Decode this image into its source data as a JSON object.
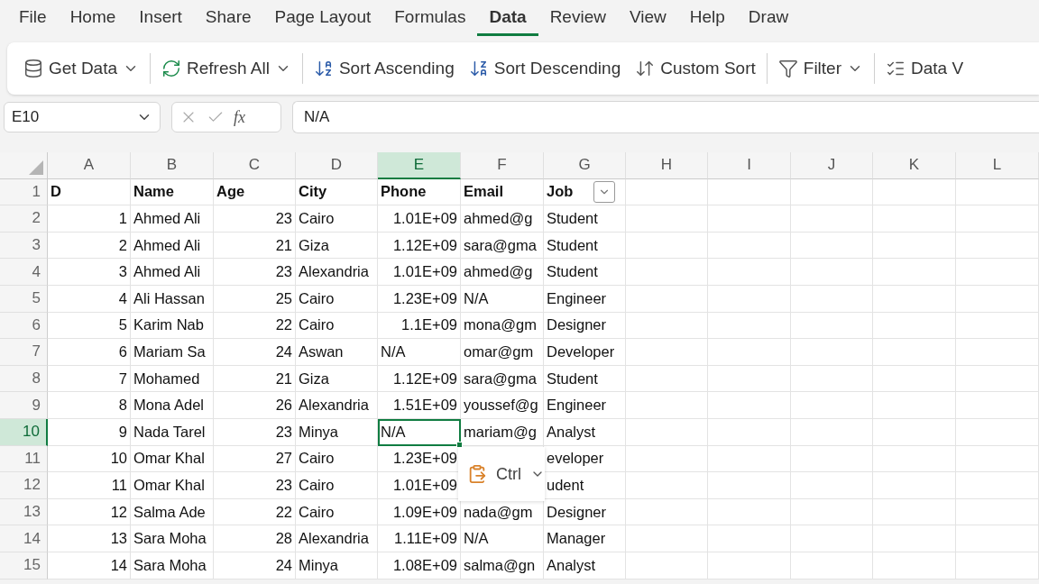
{
  "menu_tabs": [
    {
      "label": "File",
      "selected": false
    },
    {
      "label": "Home",
      "selected": false
    },
    {
      "label": "Insert",
      "selected": false
    },
    {
      "label": "Share",
      "selected": false
    },
    {
      "label": "Page Layout",
      "selected": false
    },
    {
      "label": "Formulas",
      "selected": false
    },
    {
      "label": "Data",
      "selected": true
    },
    {
      "label": "Review",
      "selected": false
    },
    {
      "label": "View",
      "selected": false
    },
    {
      "label": "Help",
      "selected": false
    },
    {
      "label": "Draw",
      "selected": false
    }
  ],
  "toolbar": [
    {
      "kind": "get-data",
      "label": "Get Data",
      "dropdown": true
    },
    {
      "kind": "separator"
    },
    {
      "kind": "refresh",
      "label": "Refresh All",
      "dropdown": true
    },
    {
      "kind": "separator"
    },
    {
      "kind": "sort-asc",
      "label": "Sort Ascending",
      "dropdown": false
    },
    {
      "kind": "sort-desc",
      "label": "Sort Descending",
      "dropdown": false
    },
    {
      "kind": "custom-sort",
      "label": "Custom Sort",
      "dropdown": false
    },
    {
      "kind": "separator"
    },
    {
      "kind": "filter",
      "label": "Filter",
      "dropdown": true
    },
    {
      "kind": "separator"
    },
    {
      "kind": "validation",
      "label": "Data V",
      "dropdown": false
    }
  ],
  "formula_bar": {
    "name_box": "E10",
    "function_label": "fx",
    "value": "N/A"
  },
  "columns": [
    {
      "label": "A",
      "selected": false
    },
    {
      "label": "B",
      "selected": false
    },
    {
      "label": "C",
      "selected": false
    },
    {
      "label": "D",
      "selected": false
    },
    {
      "label": "E",
      "selected": true
    },
    {
      "label": "F",
      "selected": false
    },
    {
      "label": "G",
      "selected": false
    },
    {
      "label": "H",
      "selected": false
    },
    {
      "label": "I",
      "selected": false
    },
    {
      "label": "J",
      "selected": false
    },
    {
      "label": "K",
      "selected": false
    },
    {
      "label": "L",
      "selected": false
    }
  ],
  "rows": [
    {
      "number": "1",
      "selected": false,
      "cells": [
        {
          "text": "D",
          "kind": "heading",
          "selected": false
        },
        {
          "text": "Name",
          "kind": "heading",
          "selected": false
        },
        {
          "text": "Age",
          "kind": "heading",
          "selected": false
        },
        {
          "text": "City",
          "kind": "heading",
          "selected": false
        },
        {
          "text": "Phone",
          "kind": "heading",
          "selected": false
        },
        {
          "text": "Email",
          "kind": "heading",
          "selected": false
        },
        {
          "text": "Job",
          "kind": "heading-filter",
          "selected": false
        }
      ]
    },
    {
      "number": "2",
      "selected": false,
      "cells": [
        {
          "text": "1",
          "kind": "number",
          "selected": false
        },
        {
          "text": "Ahmed Ali",
          "kind": "text",
          "selected": false
        },
        {
          "text": "23",
          "kind": "number",
          "selected": false
        },
        {
          "text": "Cairo",
          "kind": "text",
          "selected": false
        },
        {
          "text": "1.01E+09",
          "kind": "number",
          "selected": false
        },
        {
          "text": "ahmed@g",
          "kind": "text",
          "selected": false
        },
        {
          "text": "Student",
          "kind": "text",
          "selected": false
        }
      ]
    },
    {
      "number": "3",
      "selected": false,
      "cells": [
        {
          "text": "2",
          "kind": "number",
          "selected": false
        },
        {
          "text": "Ahmed Ali",
          "kind": "text",
          "selected": false
        },
        {
          "text": "21",
          "kind": "number",
          "selected": false
        },
        {
          "text": "Giza",
          "kind": "text",
          "selected": false
        },
        {
          "text": "1.12E+09",
          "kind": "number",
          "selected": false
        },
        {
          "text": "sara@gma",
          "kind": "text",
          "selected": false
        },
        {
          "text": "Student",
          "kind": "text",
          "selected": false
        }
      ]
    },
    {
      "number": "4",
      "selected": false,
      "cells": [
        {
          "text": "3",
          "kind": "number",
          "selected": false
        },
        {
          "text": "Ahmed Ali",
          "kind": "text",
          "selected": false
        },
        {
          "text": "23",
          "kind": "number",
          "selected": false
        },
        {
          "text": "Alexandria",
          "kind": "text",
          "selected": false
        },
        {
          "text": "1.01E+09",
          "kind": "number",
          "selected": false
        },
        {
          "text": "ahmed@g",
          "kind": "text",
          "selected": false
        },
        {
          "text": "Student",
          "kind": "text",
          "selected": false
        }
      ]
    },
    {
      "number": "5",
      "selected": false,
      "cells": [
        {
          "text": "4",
          "kind": "number",
          "selected": false
        },
        {
          "text": "Ali Hassan",
          "kind": "text",
          "selected": false
        },
        {
          "text": "25",
          "kind": "number",
          "selected": false
        },
        {
          "text": "Cairo",
          "kind": "text",
          "selected": false
        },
        {
          "text": "1.23E+09",
          "kind": "number",
          "selected": false
        },
        {
          "text": "N/A",
          "kind": "text",
          "selected": false
        },
        {
          "text": "Engineer",
          "kind": "text",
          "selected": false
        }
      ]
    },
    {
      "number": "6",
      "selected": false,
      "cells": [
        {
          "text": "5",
          "kind": "number",
          "selected": false
        },
        {
          "text": "Karim Nab",
          "kind": "text",
          "selected": false
        },
        {
          "text": "22",
          "kind": "number",
          "selected": false
        },
        {
          "text": "Cairo",
          "kind": "text",
          "selected": false
        },
        {
          "text": "1.1E+09",
          "kind": "number",
          "selected": false
        },
        {
          "text": "mona@gm",
          "kind": "text",
          "selected": false
        },
        {
          "text": "Designer",
          "kind": "text",
          "selected": false
        }
      ]
    },
    {
      "number": "7",
      "selected": false,
      "cells": [
        {
          "text": "6",
          "kind": "number",
          "selected": false
        },
        {
          "text": "Mariam Sa",
          "kind": "text",
          "selected": false
        },
        {
          "text": "24",
          "kind": "number",
          "selected": false
        },
        {
          "text": "Aswan",
          "kind": "text",
          "selected": false
        },
        {
          "text": "N/A",
          "kind": "text",
          "selected": false
        },
        {
          "text": "omar@gm",
          "kind": "text",
          "selected": false
        },
        {
          "text": "Developer",
          "kind": "text",
          "selected": false
        }
      ]
    },
    {
      "number": "8",
      "selected": false,
      "cells": [
        {
          "text": "7",
          "kind": "number",
          "selected": false
        },
        {
          "text": "Mohamed",
          "kind": "text",
          "selected": false
        },
        {
          "text": "21",
          "kind": "number",
          "selected": false
        },
        {
          "text": "Giza",
          "kind": "text",
          "selected": false
        },
        {
          "text": "1.12E+09",
          "kind": "number",
          "selected": false
        },
        {
          "text": "sara@gma",
          "kind": "text",
          "selected": false
        },
        {
          "text": "Student",
          "kind": "text",
          "selected": false
        }
      ]
    },
    {
      "number": "9",
      "selected": false,
      "cells": [
        {
          "text": "8",
          "kind": "number",
          "selected": false
        },
        {
          "text": "Mona Adel",
          "kind": "text",
          "selected": false
        },
        {
          "text": "26",
          "kind": "number",
          "selected": false
        },
        {
          "text": "Alexandria",
          "kind": "text",
          "selected": false
        },
        {
          "text": "1.51E+09",
          "kind": "number",
          "selected": false
        },
        {
          "text": "youssef@g",
          "kind": "text",
          "selected": false
        },
        {
          "text": "Engineer",
          "kind": "text",
          "selected": false
        }
      ]
    },
    {
      "number": "10",
      "selected": true,
      "cells": [
        {
          "text": "9",
          "kind": "number",
          "selected": false
        },
        {
          "text": "Nada Tarel",
          "kind": "text",
          "selected": false
        },
        {
          "text": "23",
          "kind": "number",
          "selected": false
        },
        {
          "text": "Minya",
          "kind": "text",
          "selected": false
        },
        {
          "text": "N/A",
          "kind": "text",
          "selected": true
        },
        {
          "text": "mariam@g",
          "kind": "text",
          "selected": false
        },
        {
          "text": "Analyst",
          "kind": "text",
          "selected": false
        }
      ]
    },
    {
      "number": "11",
      "selected": false,
      "cells": [
        {
          "text": "10",
          "kind": "number",
          "selected": false
        },
        {
          "text": "Omar Khal",
          "kind": "text",
          "selected": false
        },
        {
          "text": "27",
          "kind": "number",
          "selected": false
        },
        {
          "text": "Cairo",
          "kind": "text",
          "selected": false
        },
        {
          "text": "1.23E+09",
          "kind": "number",
          "selected": false
        },
        {
          "kind": "covered"
        },
        {
          "text": "eveloper",
          "kind": "text",
          "selected": false
        }
      ]
    },
    {
      "number": "12",
      "selected": false,
      "cells": [
        {
          "text": "11",
          "kind": "number",
          "selected": false
        },
        {
          "text": "Omar Khal",
          "kind": "text",
          "selected": false
        },
        {
          "text": "23",
          "kind": "number",
          "selected": false
        },
        {
          "text": "Cairo",
          "kind": "text",
          "selected": false
        },
        {
          "text": "1.01E+09",
          "kind": "number",
          "selected": false
        },
        {
          "kind": "covered"
        },
        {
          "text": "udent",
          "kind": "text",
          "selected": false
        }
      ]
    },
    {
      "number": "13",
      "selected": false,
      "cells": [
        {
          "text": "12",
          "kind": "number",
          "selected": false
        },
        {
          "text": "Salma Ade",
          "kind": "text",
          "selected": false
        },
        {
          "text": "22",
          "kind": "number",
          "selected": false
        },
        {
          "text": "Cairo",
          "kind": "text",
          "selected": false
        },
        {
          "text": "1.09E+09",
          "kind": "number",
          "selected": false
        },
        {
          "text": "nada@gm",
          "kind": "text",
          "selected": false
        },
        {
          "text": "Designer",
          "kind": "text",
          "selected": false
        }
      ]
    },
    {
      "number": "14",
      "selected": false,
      "cells": [
        {
          "text": "13",
          "kind": "number",
          "selected": false
        },
        {
          "text": "Sara Moha",
          "kind": "text",
          "selected": false
        },
        {
          "text": "28",
          "kind": "number",
          "selected": false
        },
        {
          "text": "Alexandria",
          "kind": "text",
          "selected": false
        },
        {
          "text": "1.11E+09",
          "kind": "number",
          "selected": false
        },
        {
          "text": "N/A",
          "kind": "text",
          "selected": false
        },
        {
          "text": "Manager",
          "kind": "text",
          "selected": false
        }
      ]
    },
    {
      "number": "15",
      "selected": false,
      "cells": [
        {
          "text": "14",
          "kind": "number",
          "selected": false
        },
        {
          "text": "Sara Moha",
          "kind": "text",
          "selected": false
        },
        {
          "text": "24",
          "kind": "number",
          "selected": false
        },
        {
          "text": "Minya",
          "kind": "text",
          "selected": false
        },
        {
          "text": "1.08E+09",
          "kind": "number",
          "selected": false
        },
        {
          "text": "salma@gn",
          "kind": "text",
          "selected": false
        },
        {
          "text": "Analyst",
          "kind": "text",
          "selected": false
        }
      ]
    }
  ],
  "paste_popup": {
    "label": "Ctrl"
  }
}
